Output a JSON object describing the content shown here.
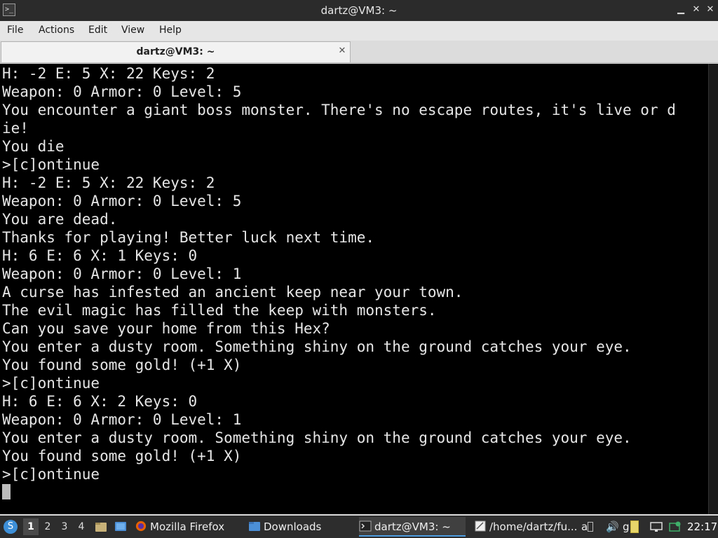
{
  "window": {
    "title": "dartz@VM3: ~",
    "app_icon": ">_",
    "minimize_icon": "minimize-icon",
    "maximize_icon": "maximize-icon",
    "close_icon": "close-icon"
  },
  "menu": {
    "file": "File",
    "actions": "Actions",
    "edit": "Edit",
    "view": "View",
    "help": "Help"
  },
  "tab": {
    "label": "dartz@VM3: ~"
  },
  "terminal": {
    "lines": [
      "H: -2 E: 5 X: 22 Keys: 2",
      "Weapon: 0 Armor: 0 Level: 5",
      "You encounter a giant boss monster. There's no escape routes, it's live or d",
      "ie!",
      "You die",
      ">[c]ontinue",
      "H: -2 E: 5 X: 22 Keys: 2",
      "Weapon: 0 Armor: 0 Level: 5",
      "You are dead.",
      "Thanks for playing! Better luck next time.",
      "H: 6 E: 6 X: 1 Keys: 0",
      "Weapon: 0 Armor: 0 Level: 1",
      "A curse has infested an ancient keep near your town.",
      "The evil magic has filled the keep with monsters.",
      "Can you save your home from this Hex?",
      "You enter a dusty room. Something shiny on the ground catches your eye.",
      "You found some gold! (+1 X)",
      ">[c]ontinue",
      "H: 6 E: 6 X: 2 Keys: 0",
      "Weapon: 0 Armor: 0 Level: 1",
      "You enter a dusty room. Something shiny on the ground catches your eye.",
      "You found some gold! (+1 X)",
      ">[c]ontinue"
    ]
  },
  "taskbar": {
    "workspaces": [
      "1",
      "2",
      "3",
      "4"
    ],
    "active_workspace": "1",
    "tasks": {
      "firefox": "Mozilla Firefox",
      "downloads": "Downloads",
      "terminal": "dartz@VM3: ~",
      "editor": "/home/dartz/fu...",
      "editor_suffix": "a"
    },
    "tray": {
      "se": "Se",
      "g": "g"
    },
    "clock": "22:17"
  },
  "colors": {
    "terminal_bg": "#000000",
    "terminal_fg": "#e6e6e6",
    "titlebar_bg": "#2b2b2b",
    "taskbar_bg": "#2d2d2d",
    "accent": "#4d9de0"
  }
}
